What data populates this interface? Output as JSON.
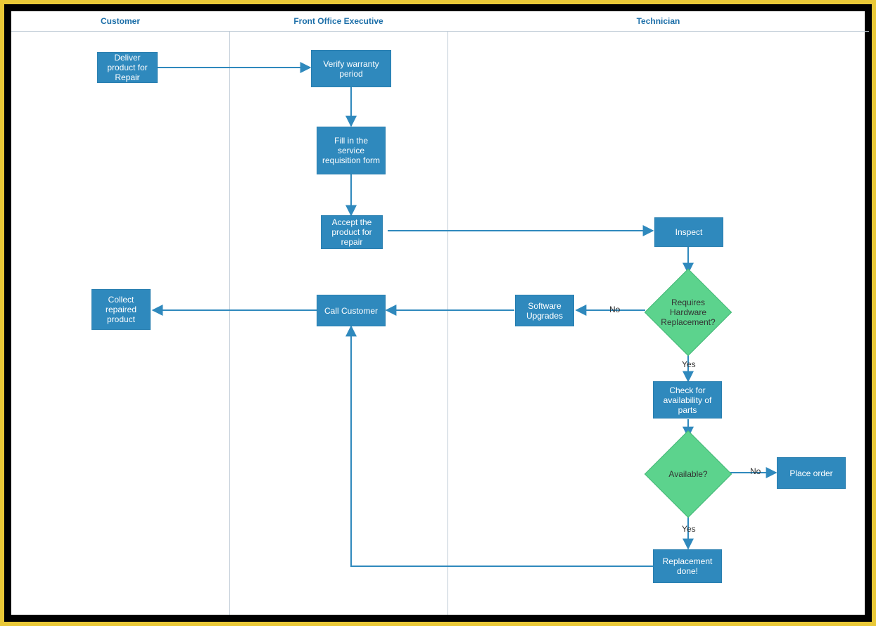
{
  "lanes": {
    "customer": "Customer",
    "front_office": "Front Office Executive",
    "technician": "Technician"
  },
  "nodes": {
    "deliver": "Deliver product for Repair",
    "verify": "Verify warranty period",
    "fill": "Fill in the service requisition form",
    "accept": "Accept the product for repair",
    "inspect": "Inspect",
    "hw_decision": "Requires Hardware Replacement?",
    "sw_upgrades": "Software Upgrades",
    "call_customer": "Call Customer",
    "collect": "Collect repaired product",
    "check_parts": "Check for availability of parts",
    "available_decision": "Available?",
    "place_order": "Place order",
    "replacement_done": "Replacement done!"
  },
  "edge_labels": {
    "no1": "No",
    "yes1": "Yes",
    "no2": "No",
    "yes2": "Yes"
  },
  "colors": {
    "process": "#2f89bd",
    "decision": "#5cd38d",
    "arrow": "#2f89bd",
    "lane_border": "#bfcbd6",
    "lane_text": "#1b6ea8"
  }
}
